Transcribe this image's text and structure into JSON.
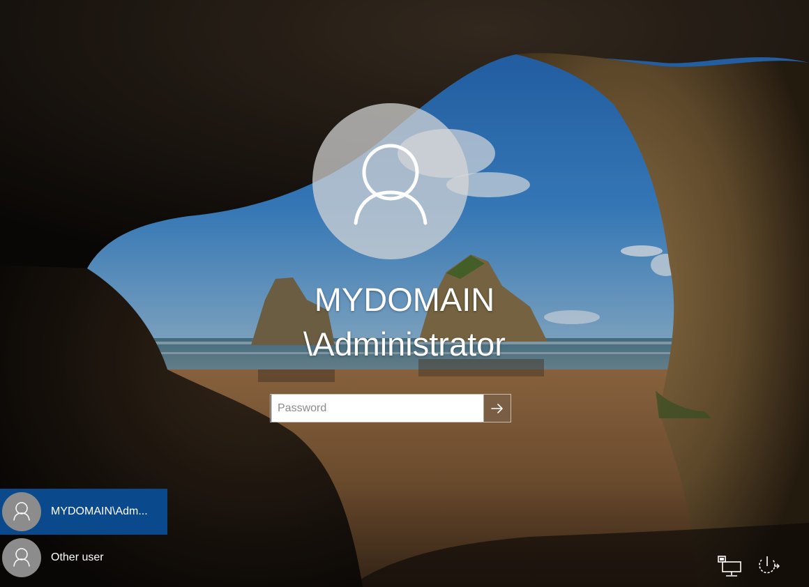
{
  "login": {
    "username_line1": "MYDOMAIN",
    "username_line2": "\\Administrator",
    "password_placeholder": "Password",
    "submit_icon": "arrow-right-icon"
  },
  "user_list": [
    {
      "label": "MYDOMAIN\\Adm...",
      "selected": true,
      "icon": "user-icon"
    },
    {
      "label": "Other user",
      "selected": false,
      "icon": "user-icon"
    }
  ],
  "bottom_right_icons": [
    "network-icon",
    "power-icon"
  ],
  "colors": {
    "selected_user_bg": "#0a4a8c",
    "avatar_bg": "#8c8c8c"
  }
}
